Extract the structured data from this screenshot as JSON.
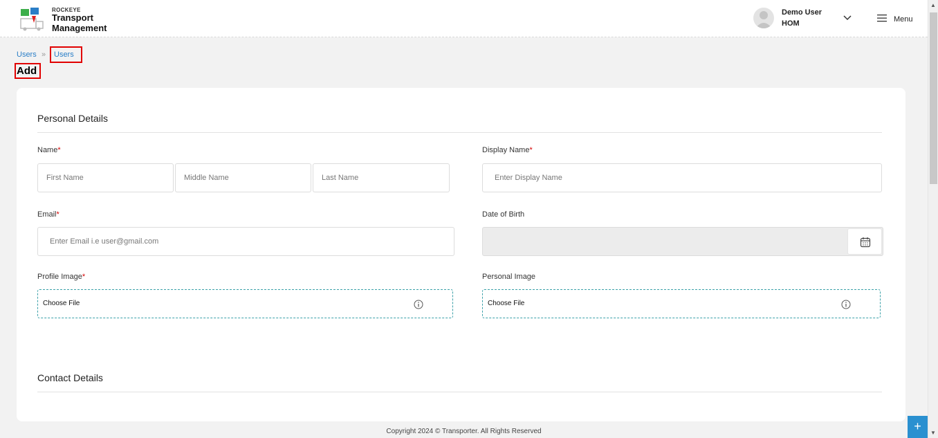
{
  "header": {
    "brand_small": "ROCKEYE",
    "brand_line1": "Transport",
    "brand_line2": "Management",
    "user_name": "Demo User",
    "user_role": "HOM",
    "menu_label": "Menu"
  },
  "breadcrumb": {
    "item1": "Users",
    "item2": "Users"
  },
  "page_title": "Add",
  "personal_section": {
    "title": "Personal Details",
    "name_label": "Name",
    "first_name_placeholder": "First Name",
    "middle_name_placeholder": "Middle Name",
    "last_name_placeholder": "Last Name",
    "display_name_label": "Display Name",
    "display_name_placeholder": "Enter Display Name",
    "email_label": "Email",
    "email_placeholder": "Enter Email i.e user@gmail.com",
    "dob_label": "Date of Birth",
    "profile_image_label": "Profile Image",
    "personal_image_label": "Personal Image",
    "choose_file_label": "Choose File",
    "required_mark": "*"
  },
  "contact_section": {
    "title": "Contact Details"
  },
  "footer": {
    "copyright": "Copyright 2024 © Transporter. All Rights Reserved"
  },
  "fab_label": "+",
  "colors": {
    "link": "#2a7ec7",
    "highlight_border": "#e10000",
    "required": "#d40000",
    "fab": "#2a90d0",
    "file_border": "#3aa0a8"
  },
  "icons": [
    "logo-icon",
    "avatar-icon",
    "chevron-down-icon",
    "hamburger-menu-icon",
    "calendar-icon",
    "info-icon",
    "plus-icon"
  ]
}
